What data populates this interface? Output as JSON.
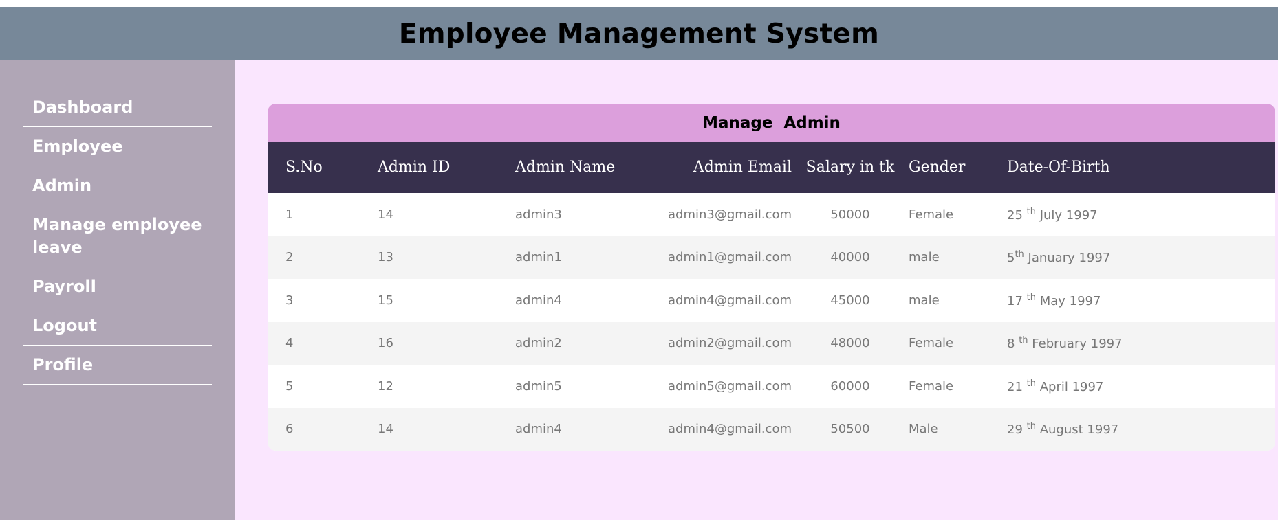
{
  "header": {
    "title": "Employee Management System"
  },
  "sidebar": {
    "items": [
      {
        "label": "Dashboard"
      },
      {
        "label": "Employee"
      },
      {
        "label": "Admin"
      },
      {
        "label": "Manage employee leave"
      },
      {
        "label": "Payroll"
      },
      {
        "label": "Logout"
      },
      {
        "label": "Profile"
      }
    ]
  },
  "panel": {
    "title": "Manage  Admin"
  },
  "table": {
    "headers": [
      "S.No",
      "Admin ID",
      "Admin Name",
      "Admin Email",
      "Salary in tk",
      "Gender",
      "Date-Of-Birth"
    ],
    "rows": [
      {
        "sno": "1",
        "id": "14",
        "name": "admin3",
        "email": "admin3@gmail.com",
        "salary": "50000",
        "gender": "Female",
        "dob_day": "25 ",
        "dob_sup": "th",
        "dob_rest": " July 1997"
      },
      {
        "sno": "2",
        "id": "13",
        "name": "admin1",
        "email": "admin1@gmail.com",
        "salary": "40000",
        "gender": "male",
        "dob_day": "5",
        "dob_sup": "th",
        "dob_rest": " January 1997"
      },
      {
        "sno": "3",
        "id": "15",
        "name": "admin4",
        "email": "admin4@gmail.com",
        "salary": "45000",
        "gender": "male",
        "dob_day": "17 ",
        "dob_sup": "th",
        "dob_rest": " May 1997"
      },
      {
        "sno": "4",
        "id": "16",
        "name": "admin2",
        "email": "admin2@gmail.com",
        "salary": "48000",
        "gender": "Female",
        "dob_day": "8 ",
        "dob_sup": "th",
        "dob_rest": " February 1997"
      },
      {
        "sno": "5",
        "id": "12",
        "name": "admin5",
        "email": "admin5@gmail.com",
        "salary": "60000",
        "gender": "Female",
        "dob_day": "21 ",
        "dob_sup": "th",
        "dob_rest": " April 1997"
      },
      {
        "sno": "6",
        "id": "14",
        "name": "admin4",
        "email": "admin4@gmail.com",
        "salary": "50500",
        "gender": "Male",
        "dob_day": "29 ",
        "dob_sup": "th",
        "dob_rest": " August 1997"
      }
    ]
  },
  "colors": {
    "header_bg": "#778899",
    "sidebar_bg": "#b0a6b6",
    "main_bg": "#fae6fe",
    "panel_title_bg": "#dc9fdc",
    "table_head_bg": "#37304d"
  }
}
